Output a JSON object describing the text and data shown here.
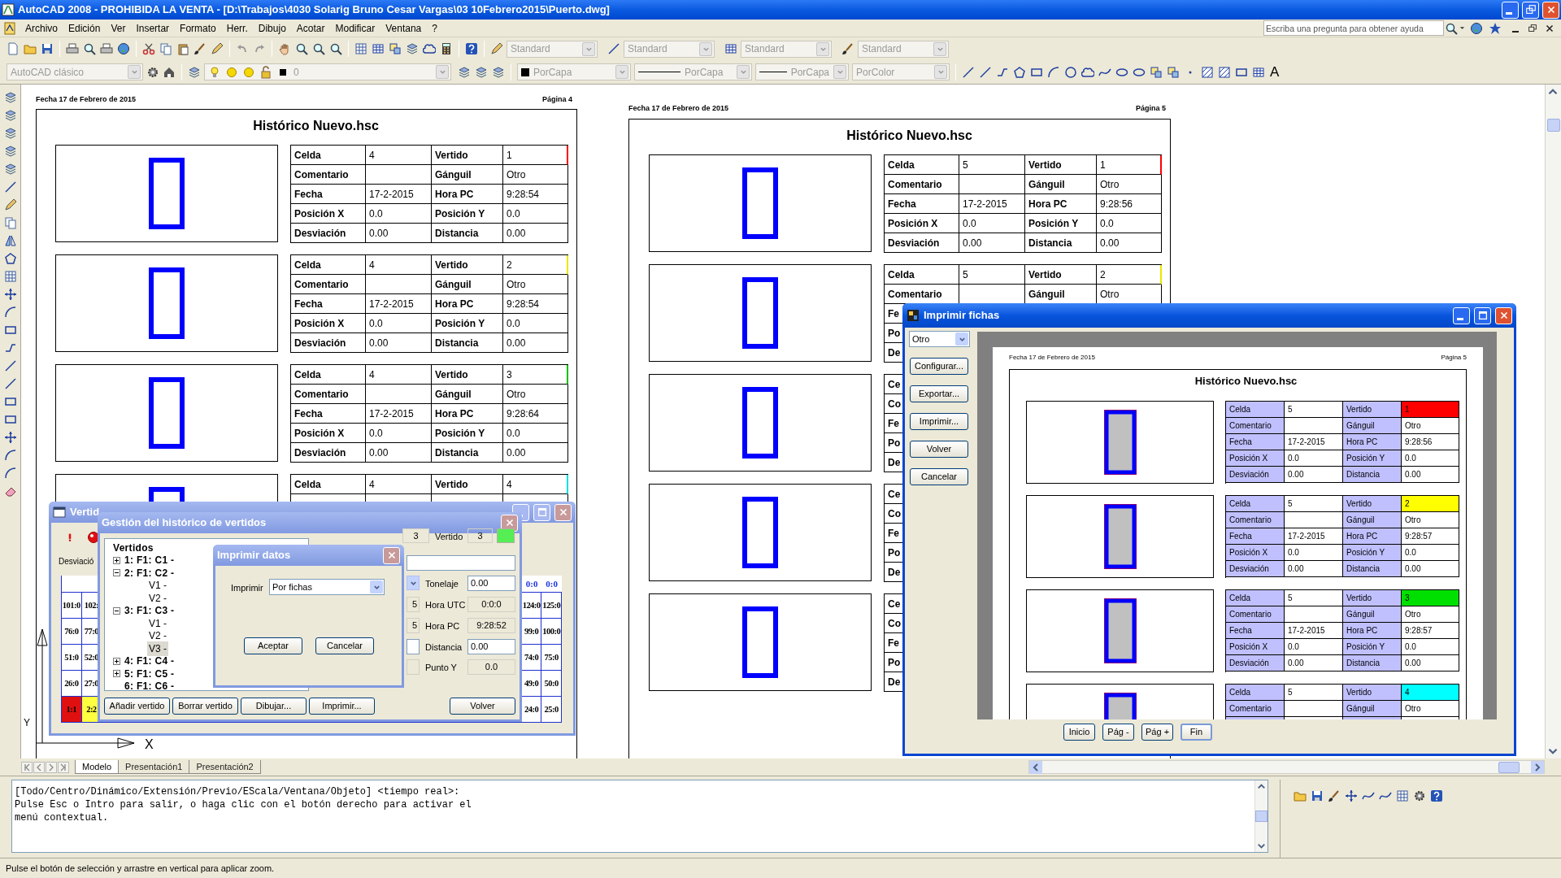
{
  "window": {
    "title": "AutoCAD 2008 - PROHIBIDA LA VENTA - [D:\\Trabajos\\4030 Solarig Bruno Cesar Vargas\\03 10Febrero2015\\Puerto.dwg]"
  },
  "menu": [
    "Archivo",
    "Edición",
    "Ver",
    "Insertar",
    "Formato",
    "Herr.",
    "Dibujo",
    "Acotar",
    "Modificar",
    "Ventana",
    "?"
  ],
  "help_search": {
    "placeholder": "Escriba una pregunta para obtener ayuda"
  },
  "styles_toolbar": [
    "Standard",
    "Standard",
    "Standard",
    "Standard"
  ],
  "workspace": "AutoCAD clásico",
  "layer": "0",
  "properties": [
    {
      "kind": "color",
      "text": "PorCapa"
    },
    {
      "kind": "linetype",
      "text": "PorCapa"
    },
    {
      "kind": "linetype",
      "text": "PorCapa"
    },
    {
      "kind": "plain",
      "text": "PorColor"
    }
  ],
  "draw_toolbar": {
    "mtext": "A"
  },
  "sheets": [
    {
      "date": "Fecha 17 de Febrero de 2015",
      "page": "Página 4",
      "title": "Histórico Nuevo.hsc",
      "cards": [
        {
          "color": "#ff0000",
          "rows": [
            {
              "label": "Celda",
              "value": "4",
              "label_2": "Vertido",
              "value_2": "1"
            },
            {
              "label": "Comentario",
              "label_2": "Gánguil",
              "value_2": "Otro"
            },
            {
              "label": "Fecha",
              "value": "17-2-2015",
              "label_2": "Hora PC",
              "value_2": "9:28:54"
            },
            {
              "label": "Posición X",
              "value": "0.0",
              "label_2": "Posición Y",
              "value_2": "0.0"
            },
            {
              "label": "Desviación",
              "value": "0.00",
              "label_2": "Distancia",
              "value_2": "0.00"
            }
          ]
        },
        {
          "color": "#e8e800",
          "rows": [
            {
              "label": "Celda",
              "value": "4",
              "label_2": "Vertido",
              "value_2": "2"
            },
            {
              "label": "Comentario",
              "label_2": "Gánguil",
              "value_2": "Otro"
            },
            {
              "label": "Fecha",
              "value": "17-2-2015",
              "label_2": "Hora PC",
              "value_2": "9:28:54"
            },
            {
              "label": "Posición X",
              "value": "0.0",
              "label_2": "Posición Y",
              "value_2": "0.0"
            },
            {
              "label": "Desviación",
              "value": "0.00",
              "label_2": "Distancia",
              "value_2": "0.00"
            }
          ]
        },
        {
          "color": "#00c000",
          "rows": [
            {
              "label": "Celda",
              "value": "4",
              "label_2": "Vertido",
              "value_2": "3"
            },
            {
              "label": "Comentario",
              "label_2": "Gánguil",
              "value_2": "Otro"
            },
            {
              "label": "Fecha",
              "value": "17-2-2015",
              "label_2": "Hora PC",
              "value_2": "9:28:64"
            },
            {
              "label": "Posición X",
              "value": "0.0",
              "label_2": "Posición Y",
              "value_2": "0.0"
            },
            {
              "label": "Desviación",
              "value": "0.00",
              "label_2": "Distancia",
              "value_2": "0.00"
            }
          ]
        },
        {
          "color": "#00e0e0",
          "rows": [
            {
              "label": "Celda",
              "value": "4",
              "label_2": "Vertido",
              "value_2": "4"
            }
          ]
        }
      ]
    },
    {
      "date": "Fecha 17 de Febrero de 2015",
      "page": "Página 5",
      "title": "Histórico Nuevo.hsc",
      "cards": [
        {
          "color": "#ff0000",
          "rows": [
            {
              "label": "Celda",
              "value": "5",
              "label_2": "Vertido",
              "value_2": "1"
            },
            {
              "label": "Comentario",
              "label_2": "Gánguil",
              "value_2": "Otro"
            },
            {
              "label": "Fecha",
              "value": "17-2-2015",
              "label_2": "Hora PC",
              "value_2": "9:28:56"
            },
            {
              "label": "Posición X",
              "value": "0.0",
              "label_2": "Posición Y",
              "value_2": "0.0"
            },
            {
              "label": "Desviación",
              "value": "0.00",
              "label_2": "Distancia",
              "value_2": "0.00"
            }
          ]
        },
        {
          "color": "#e8e800",
          "rows": [
            {
              "label": "Celda",
              "value": "5",
              "label_2": "Vertido",
              "value_2": "2"
            },
            {
              "label": "Comentario",
              "label_2": "Gánguil",
              "value_2": "Otro"
            },
            {
              "label": "Fe"
            },
            {
              "label": "Po"
            },
            {
              "label": "De"
            }
          ]
        },
        {
          "rows": [
            {
              "label": "Ce"
            },
            {
              "label": "Co"
            },
            {
              "label": "Fe"
            },
            {
              "label": "Po"
            },
            {
              "label": "De"
            }
          ]
        },
        {
          "rows": [
            {
              "label": "Ce"
            },
            {
              "label": "Co"
            },
            {
              "label": "Fe"
            },
            {
              "label": "Po"
            },
            {
              "label": "De"
            }
          ]
        },
        {
          "rows": [
            {
              "label": "Ce"
            },
            {
              "label": "Co"
            },
            {
              "label": "Fe"
            },
            {
              "label": "Po"
            },
            {
              "label": "De"
            }
          ]
        }
      ]
    }
  ],
  "ucs": {
    "y": "Y",
    "x": "X"
  },
  "vertidos_window": {
    "title": "Vertid",
    "active": false,
    "label": "Desviació",
    "grid": {
      "header": [
        "0:0",
        "0:0"
      ],
      "rows": [
        {
          "left": [
            {
              "text": "101:0"
            },
            {
              "text": "102:"
            }
          ],
          "right": [
            {
              "text": "124:0"
            },
            {
              "text": "125:0"
            }
          ]
        },
        {
          "left": [
            {
              "text": "76:0"
            },
            {
              "text": "77:0"
            }
          ],
          "right": [
            {
              "text": "99:0"
            },
            {
              "text": "100:0"
            }
          ]
        },
        {
          "left": [
            {
              "text": "51:0"
            },
            {
              "text": "52:0"
            }
          ],
          "right": [
            {
              "text": "74:0"
            },
            {
              "text": "75:0"
            }
          ]
        },
        {
          "left": [
            {
              "text": "26:0"
            },
            {
              "text": "27:0"
            }
          ],
          "right": [
            {
              "text": "49:0"
            },
            {
              "text": "50:0"
            }
          ]
        },
        {
          "left": [
            {
              "text": "1:1",
              "color": "#e01010"
            },
            {
              "text": "2:2",
              "color": "#ffff40"
            }
          ],
          "right": [
            {
              "text": "24:0"
            },
            {
              "text": "25:0"
            }
          ]
        }
      ]
    }
  },
  "gestion_dialog": {
    "title": "Gestión del histórico de vertidos",
    "active": false,
    "tree": {
      "label": "Vertidos",
      "selected": false,
      "children": [
        {
          "label": "1: F1: C1 -",
          "expanded": false,
          "selected": false
        },
        {
          "label": "2: F1: C2 -",
          "expanded": true,
          "selected": false,
          "children": [
            {
              "label": "V1 -",
              "selected": false
            },
            {
              "label": "V2 -",
              "selected": false
            }
          ]
        },
        {
          "label": "3: F1: C3 -",
          "expanded": true,
          "selected": false,
          "children": [
            {
              "label": "V1 -",
              "selected": false
            },
            {
              "label": "V2 -",
              "selected": false
            },
            {
              "label": "V3 -",
              "selected": true
            }
          ]
        },
        {
          "label": "4: F1: C4 -",
          "expanded": false,
          "selected": false
        },
        {
          "label": "5: F1: C5 -",
          "expanded": false,
          "selected": false
        },
        {
          "label": "6: F1: C6 -",
          "selected": false
        }
      ]
    },
    "current": {
      "cell": "3",
      "label": "Vertido",
      "value": "3",
      "color": "#55ee55"
    },
    "details": [
      {
        "label": "Tonelaje",
        "value": "0.00",
        "editable": true,
        "stub": {
          "kind": "dropdown"
        }
      },
      {
        "label": "Hora UTC",
        "value": "0:0:0",
        "editable": false,
        "stub": {
          "kind": "field",
          "text": "5"
        }
      },
      {
        "label": "Hora PC",
        "value": "9:28:52",
        "editable": false,
        "stub": {
          "kind": "field",
          "text": "5"
        }
      },
      {
        "label": "Distancia",
        "value": "0.00",
        "editable": true,
        "stub": {
          "kind": "input"
        }
      },
      {
        "label": "Punto Y",
        "value": "0.0",
        "editable": false,
        "stub": {
          "kind": "field"
        }
      }
    ],
    "buttons": [
      "Añadir vertido",
      "Borrar vertido",
      "Dibujar...",
      "Imprimir...",
      "Volver"
    ]
  },
  "imprimir_datos": {
    "title": "Imprimir datos",
    "active": false,
    "field_label": "Imprimir",
    "select": "Por fichas",
    "buttons": [
      "Aceptar",
      "Cancelar"
    ]
  },
  "imprimir_fichas": {
    "title": "Imprimir fichas",
    "active": true,
    "select": "Otro",
    "side_buttons": [
      "Configurar...",
      "Exportar...",
      "Imprimir...",
      "Volver",
      "Cancelar"
    ],
    "preview": {
      "date": "Fecha 17 de Febrero de 2015",
      "page": "Página 5",
      "title": "Histórico Nuevo.hsc",
      "cards": [
        {
          "color": "#ff0000",
          "rows": [
            {
              "label": "Celda",
              "value": "5",
              "label_2": "Vertido",
              "value_2": "1"
            },
            {
              "label": "Comentario",
              "label_2": "Gánguil",
              "value_2": "Otro"
            },
            {
              "label": "Fecha",
              "value": "17-2-2015",
              "label_2": "Hora PC",
              "value_2": "9:28:56"
            },
            {
              "label": "Posición X",
              "value": "0.0",
              "label_2": "Posición Y",
              "value_2": "0.0"
            },
            {
              "label": "Desviación",
              "value": "0.00",
              "label_2": "Distancia",
              "value_2": "0.00"
            }
          ]
        },
        {
          "color": "#ffff00",
          "rows": [
            {
              "label": "Celda",
              "value": "5",
              "label_2": "Vertido",
              "value_2": "2"
            },
            {
              "label": "Comentario",
              "label_2": "Gánguil",
              "value_2": "Otro"
            },
            {
              "label": "Fecha",
              "value": "17-2-2015",
              "label_2": "Hora PC",
              "value_2": "9:28:57"
            },
            {
              "label": "Posición X",
              "value": "0.0",
              "label_2": "Posición Y",
              "value_2": "0.0"
            },
            {
              "label": "Desviación",
              "value": "0.00",
              "label_2": "Distancia",
              "value_2": "0.00"
            }
          ]
        },
        {
          "color": "#00e000",
          "rows": [
            {
              "label": "Celda",
              "value": "5",
              "label_2": "Vertido",
              "value_2": "3"
            },
            {
              "label": "Comentario",
              "label_2": "Gánguil",
              "value_2": "Otro"
            },
            {
              "label": "Fecha",
              "value": "17-2-2015",
              "label_2": "Hora PC",
              "value_2": "9:28:57"
            },
            {
              "label": "Posición X",
              "value": "0.0",
              "label_2": "Posición Y",
              "value_2": "0.0"
            },
            {
              "label": "Desviación",
              "value": "0.00",
              "label_2": "Distancia",
              "value_2": "0.00"
            }
          ]
        },
        {
          "color": "#00ffff",
          "rows": [
            {
              "label": "Celda",
              "value": "5",
              "label_2": "Vertido",
              "value_2": "4"
            },
            {
              "label": "Comentario",
              "label_2": "Gánguil",
              "value_2": "Otro"
            }
          ]
        }
      ]
    },
    "nav_buttons": [
      {
        "label": "Inicio",
        "focused": false
      },
      {
        "label": "Pág -",
        "focused": false
      },
      {
        "label": "Pág +",
        "focused": false
      },
      {
        "label": "Fin",
        "focused": true
      }
    ]
  },
  "layout_tabs": [
    {
      "label": "Modelo",
      "selected": true
    },
    {
      "label": "Presentación1",
      "selected": false
    },
    {
      "label": "Presentación2",
      "selected": false
    }
  ],
  "command_lines": [
    "[Todo/Centro/Dinámico/Extensión/Previo/EScala/Ventana/Objeto] <tiempo real>:",
    "Pulse Esc o Intro para salir, o haga clic con el botón derecho para activar el",
    "menú contextual."
  ],
  "status_bar": "Pulse el botón de selección y arrastre en vertical para aplicar zoom."
}
